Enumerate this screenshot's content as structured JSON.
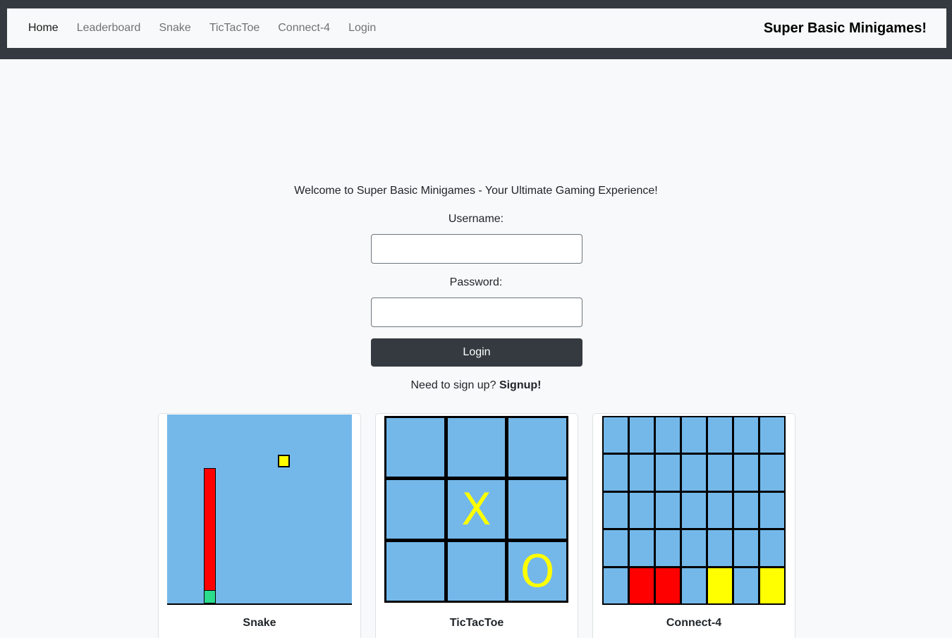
{
  "nav": {
    "links": [
      "Home",
      "Leaderboard",
      "Snake",
      "TicTacToe",
      "Connect-4",
      "Login"
    ],
    "brand": "Super Basic Minigames!"
  },
  "login": {
    "welcome": "Welcome to Super Basic Minigames - Your Ultimate Gaming Experience!",
    "username_label": "Username:",
    "username_value": "",
    "password_label": "Password:",
    "password_value": "",
    "submit_label": "Login",
    "signup_prompt": "Need to sign up?",
    "signup_link": "Signup!"
  },
  "cards": {
    "snake_title": "Snake",
    "tictactoe_title": "TicTacToe",
    "connect4_title": "Connect-4"
  },
  "tictactoe_board": [
    "",
    "",
    "",
    "",
    "X",
    "",
    "",
    "",
    "O"
  ],
  "connect4_board": [
    [
      "",
      "",
      "",
      "",
      "",
      "",
      ""
    ],
    [
      "",
      "",
      "",
      "",
      "",
      "",
      ""
    ],
    [
      "",
      "",
      "",
      "",
      "",
      "",
      ""
    ],
    [
      "",
      "",
      "",
      "",
      "",
      "",
      ""
    ],
    [
      "",
      "red",
      "red",
      "",
      "yellow",
      "",
      "yellow"
    ]
  ],
  "colors": {
    "topbar": "#343a40",
    "board": "#74b8ea",
    "snake_body": "#ff0000",
    "snake_head": "#2bdc8d",
    "food": "#ffff00",
    "piece_red": "#ff0000",
    "piece_yellow": "#ffff00"
  }
}
